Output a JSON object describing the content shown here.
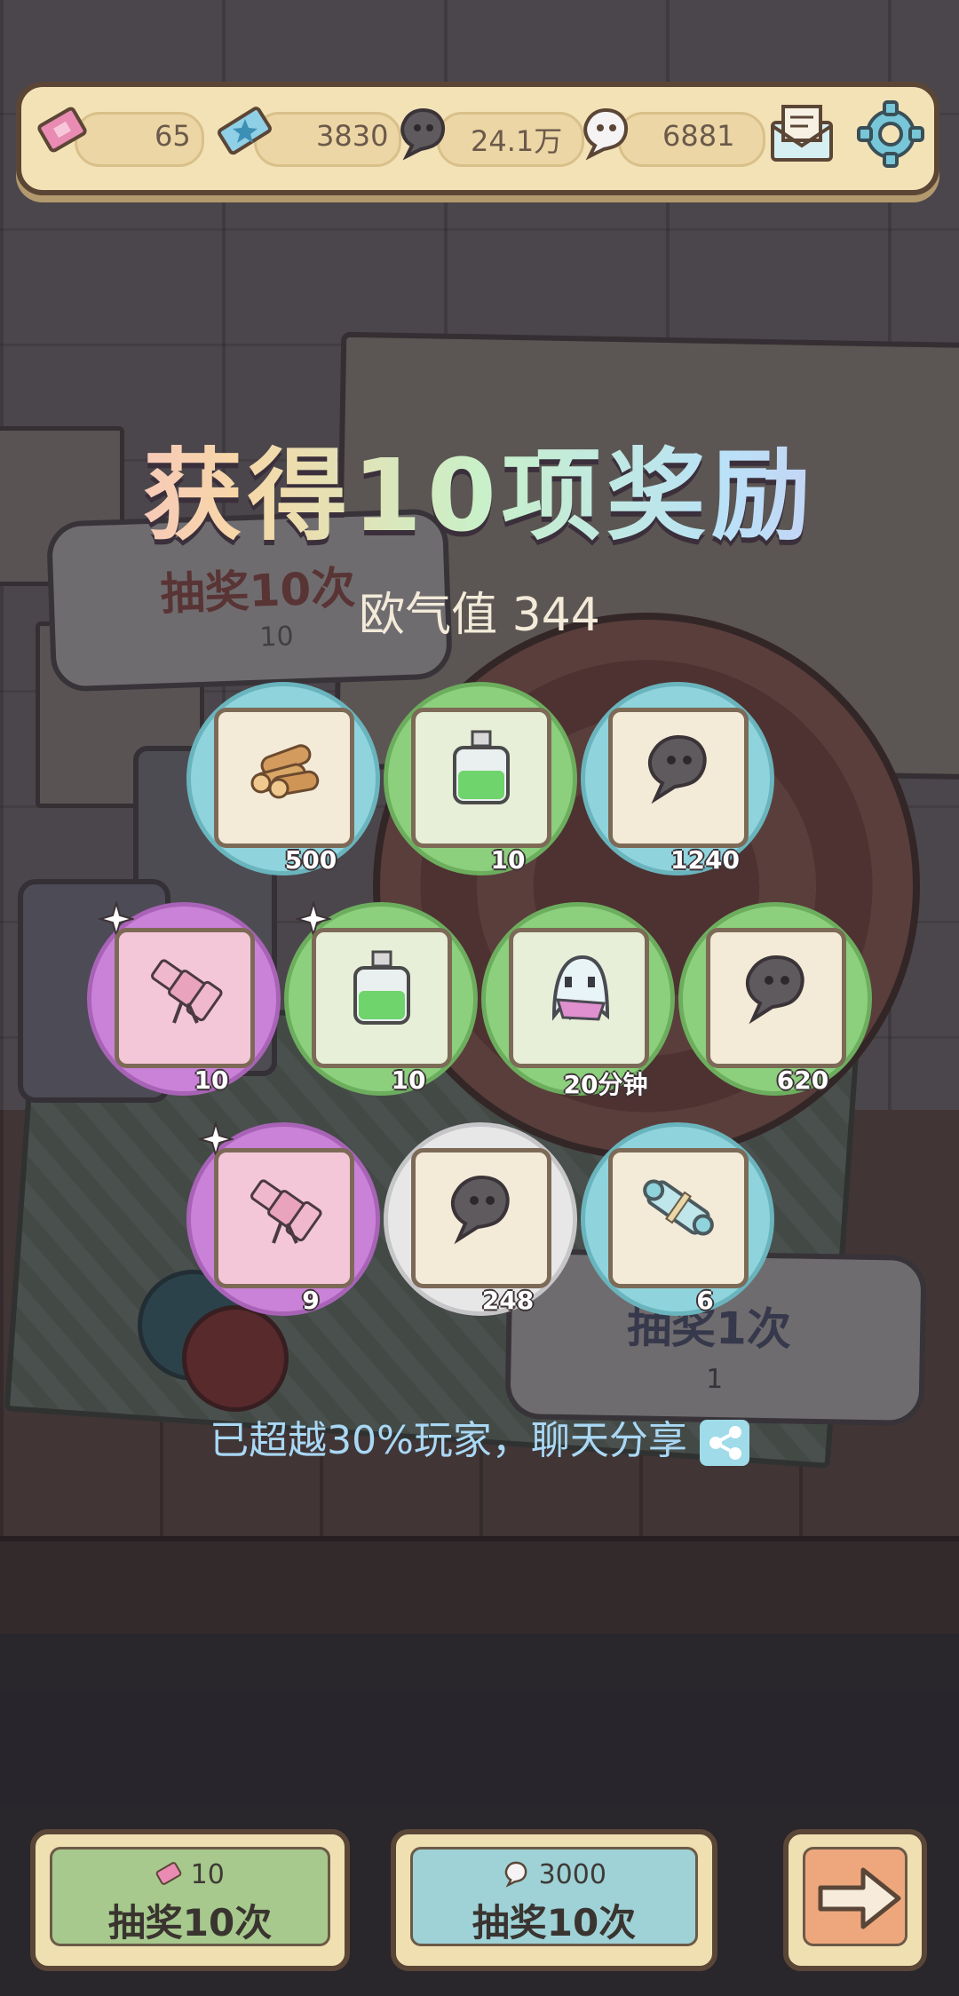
{
  "resources": {
    "lottery_tickets": "65",
    "star_tickets": "3830",
    "dark_souls": "24.1万",
    "white_souls": "6881"
  },
  "icons": {
    "ticket": "pink-ticket-icon",
    "star_ticket": "star-ticket-icon",
    "dark_soul": "dark-soul-icon",
    "white_soul": "white-soul-icon",
    "mail": "mail-icon",
    "settings": "gear-icon"
  },
  "popup": {
    "title": "获得10项奖励",
    "luck_label": "欧气值 344",
    "share_text": "已超越30%玩家，聊天分享"
  },
  "rewards": [
    {
      "item": "wood-logs",
      "count": "500",
      "rarity": "cyan"
    },
    {
      "item": "green-potion",
      "count": "10",
      "rarity": "green"
    },
    {
      "item": "dark-soul",
      "count": "1240",
      "rarity": "cyan"
    },
    {
      "item": "pink-telescope",
      "count": "10",
      "rarity": "purple",
      "new": true
    },
    {
      "item": "green-potion",
      "count": "10",
      "rarity": "green",
      "new": true
    },
    {
      "item": "ghost-cloak",
      "count": "20分钟",
      "rarity": "green"
    },
    {
      "item": "dark-soul",
      "count": "620",
      "rarity": "green"
    },
    {
      "item": "pink-telescope",
      "count": "9",
      "rarity": "purple",
      "new": true
    },
    {
      "item": "dark-soul",
      "count": "248",
      "rarity": "white"
    },
    {
      "item": "scroll",
      "count": "6",
      "rarity": "cyan"
    }
  ],
  "background_boards": {
    "left_title": "抽奖10次",
    "left_cost": "10",
    "right_title": "抽奖1次",
    "right_cost": "1"
  },
  "buttons": {
    "draw10_ticket_cost": "10",
    "draw10_ticket_label": "抽奖10次",
    "draw10_soul_cost": "3000",
    "draw10_soul_label": "抽奖10次",
    "next_label": "→"
  },
  "colors": {
    "cyan": "#8fd3dc",
    "green": "#8ccf7d",
    "purple": "#c982d8",
    "white": "#e7e7e8",
    "bar_bg": "#f3e2b6",
    "share_text": "#a9d8f5"
  }
}
